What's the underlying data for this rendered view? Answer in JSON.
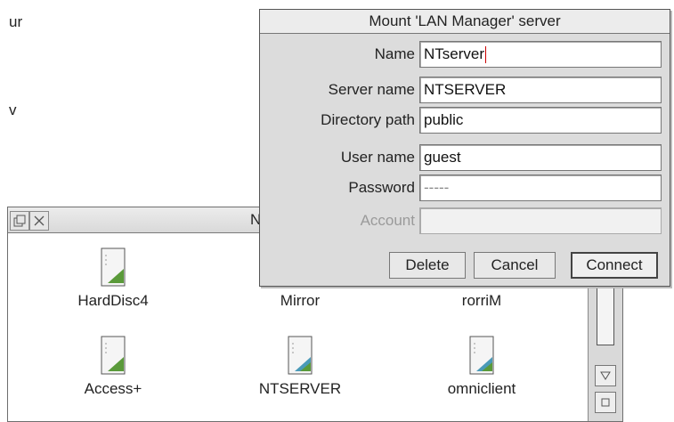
{
  "background": {
    "fragment_1": "ur",
    "fragment_2": "v"
  },
  "filer": {
    "title": "N",
    "items": [
      {
        "label": "HardDisc4"
      },
      {
        "label": "Mirror"
      },
      {
        "label": "rorriM"
      },
      {
        "label": "Access+"
      },
      {
        "label": "NTSERVER"
      },
      {
        "label": "omniclient"
      }
    ]
  },
  "dialog": {
    "title": "Mount 'LAN Manager' server",
    "fields": {
      "name": {
        "label": "Name",
        "value": "NTserver"
      },
      "server_name": {
        "label": "Server name",
        "value": "NTSERVER"
      },
      "directory_path": {
        "label": "Directory path",
        "value": "public"
      },
      "user_name": {
        "label": "User name",
        "value": "guest"
      },
      "password": {
        "label": "Password",
        "value": "-----"
      },
      "account": {
        "label": "Account",
        "value": ""
      }
    },
    "buttons": {
      "delete": "Delete",
      "cancel": "Cancel",
      "connect": "Connect"
    }
  },
  "colors": {
    "dialog_bg": "#dcdcdc",
    "icon_accent": "#5a9a3a",
    "caret": "#cc0000"
  }
}
